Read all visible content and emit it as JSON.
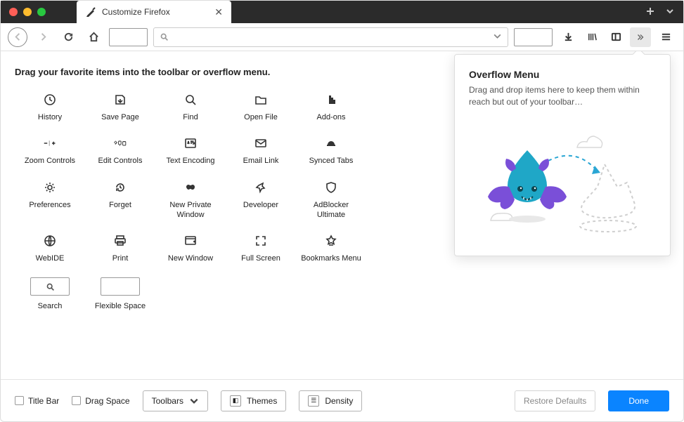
{
  "tab": {
    "title": "Customize Firefox"
  },
  "content": {
    "heading": "Drag your favorite items into the toolbar or overflow menu."
  },
  "palette": [
    {
      "id": "history",
      "label": "History"
    },
    {
      "id": "save-page",
      "label": "Save Page"
    },
    {
      "id": "find",
      "label": "Find"
    },
    {
      "id": "open-file",
      "label": "Open File"
    },
    {
      "id": "addons",
      "label": "Add-ons"
    },
    {
      "id": "zoom-controls",
      "label": "Zoom Controls"
    },
    {
      "id": "edit-controls",
      "label": "Edit Controls"
    },
    {
      "id": "text-encoding",
      "label": "Text Encoding"
    },
    {
      "id": "email-link",
      "label": "Email Link"
    },
    {
      "id": "synced-tabs",
      "label": "Synced Tabs"
    },
    {
      "id": "preferences",
      "label": "Preferences"
    },
    {
      "id": "forget",
      "label": "Forget"
    },
    {
      "id": "new-private-window",
      "label": "New Private Window"
    },
    {
      "id": "developer",
      "label": "Developer"
    },
    {
      "id": "adblocker-ultimate",
      "label": "AdBlocker Ultimate"
    },
    {
      "id": "webide",
      "label": "WebIDE"
    },
    {
      "id": "print",
      "label": "Print"
    },
    {
      "id": "new-window",
      "label": "New Window"
    },
    {
      "id": "full-screen",
      "label": "Full Screen"
    },
    {
      "id": "bookmarks-menu",
      "label": "Bookmarks Menu"
    },
    {
      "id": "search",
      "label": "Search"
    },
    {
      "id": "flexible-space",
      "label": "Flexible Space"
    }
  ],
  "overflow": {
    "title": "Overflow Menu",
    "desc": "Drag and drop items here to keep them within reach but out of your toolbar…"
  },
  "footer": {
    "titlebar": "Title Bar",
    "dragspace": "Drag Space",
    "toolbars": "Toolbars",
    "themes": "Themes",
    "density": "Density",
    "restore": "Restore Defaults",
    "done": "Done"
  }
}
